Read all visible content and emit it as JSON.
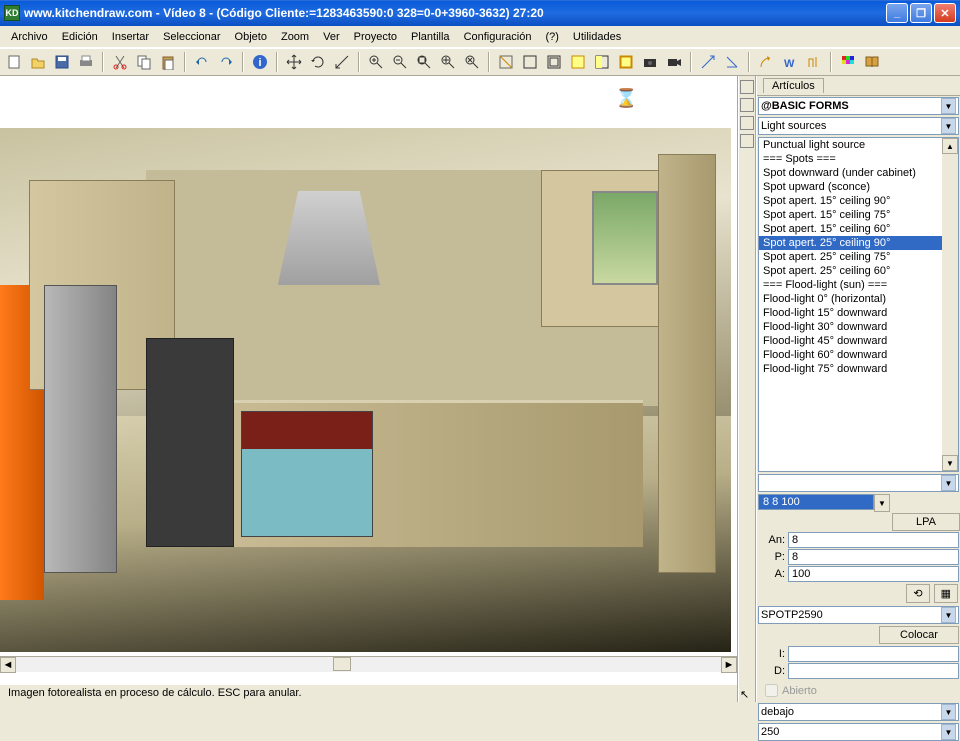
{
  "title": "www.kitchendraw.com - Vídeo 8 - (Código Cliente:=1283463590:0 328=0-0+3960-3632) 27:20",
  "app_icon": "KD",
  "menu": [
    "Archivo",
    "Edición",
    "Insertar",
    "Seleccionar",
    "Objeto",
    "Zoom",
    "Ver",
    "Proyecto",
    "Plantilla",
    "Configuración",
    "(?)",
    "Utilidades"
  ],
  "right": {
    "tab": "Artículos",
    "catalog": "@BASIC FORMS",
    "category": "Light sources",
    "items": [
      "Punctual light source",
      "=== Spots ===",
      "Spot downward (under cabinet)",
      "Spot upward (sconce)",
      "Spot apert. 15° ceiling 90°",
      "Spot apert. 15° ceiling 75°",
      "Spot apert. 15° ceiling 60°",
      "Spot apert. 25° ceiling 90°",
      "Spot apert. 25° ceiling 75°",
      "Spot apert. 25° ceiling 60°",
      "=== Flood-light (sun) ===",
      "Flood-light 0° (horizontal)",
      "Flood-light 15° downward",
      "Flood-light 30° downward",
      "Flood-light 45° downward",
      "Flood-light 60° downward",
      "Flood-light 75° downward"
    ],
    "selected_index": 7,
    "preview_dims": "8    8  100",
    "lpa": "LPA",
    "An": "8",
    "P": "8",
    "A": "100",
    "code": "SPOTP2590",
    "place": "Colocar",
    "I": "",
    "D": "",
    "abierto": "Abierto",
    "pos": "debajo",
    "num": "250"
  },
  "status": "Imagen fotorealista en proceso de cálculo. ESC para anular."
}
